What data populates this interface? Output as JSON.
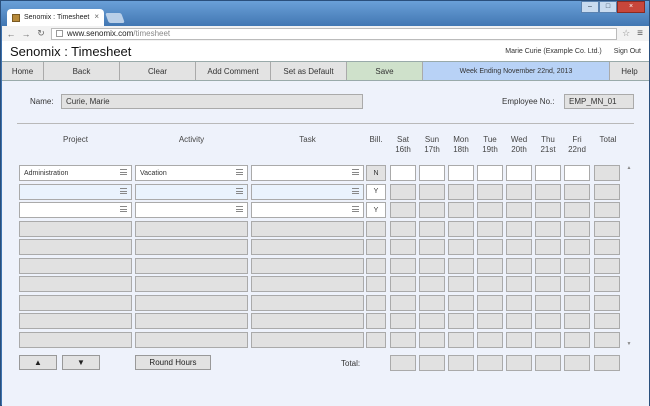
{
  "browser": {
    "tab_title": "Senomix : Timesheet",
    "url_host": "www.senomix.com",
    "url_path": "/timesheet"
  },
  "header": {
    "title": "Senomix : Timesheet",
    "user": "Marie Curie  (Example Co. Ltd.)",
    "signout": "Sign Out"
  },
  "nav": {
    "home": "Home",
    "back": "Back",
    "clear": "Clear",
    "add_comment": "Add Comment",
    "set_default": "Set as Default",
    "save": "Save",
    "week": "Week Ending November 22nd, 2013",
    "help": "Help"
  },
  "form": {
    "name_label": "Name:",
    "name_value": "Curie, Marie",
    "emp_label": "Employee No.:",
    "emp_value": "EMP_MN_01"
  },
  "columns": {
    "project": "Project",
    "activity": "Activity",
    "task": "Task",
    "bill": "Bill.",
    "days": [
      {
        "d": "Sat",
        "n": "16th"
      },
      {
        "d": "Sun",
        "n": "17th"
      },
      {
        "d": "Mon",
        "n": "18th"
      },
      {
        "d": "Tue",
        "n": "19th"
      },
      {
        "d": "Wed",
        "n": "20th"
      },
      {
        "d": "Thu",
        "n": "21st"
      },
      {
        "d": "Fri",
        "n": "22nd"
      }
    ],
    "total": "Total"
  },
  "rows": [
    {
      "project": "Administration",
      "activity": "Vacation",
      "task": "",
      "bill": "N"
    },
    {
      "project": "",
      "activity": "",
      "task": "",
      "bill": "Y"
    },
    {
      "project": "",
      "activity": "",
      "task": "",
      "bill": "Y"
    }
  ],
  "footer": {
    "up": "▲",
    "down": "▼",
    "round": "Round Hours",
    "total_label": "Total:"
  }
}
